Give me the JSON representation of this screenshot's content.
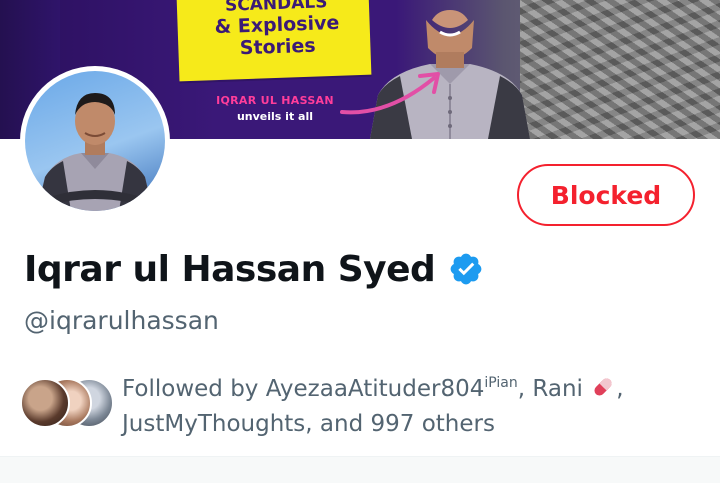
{
  "banner": {
    "headline_line1": "SCANDALS",
    "headline_line2": "& Explosive",
    "headline_line3": "Stories",
    "caption_name": "IQRAR UL HASSAN",
    "caption_sub": "unveils it all",
    "sticker_color": "#f6ea1a",
    "headline_color": "#3b1a77",
    "caption_accent": "#ff3d9a"
  },
  "profile": {
    "display_name": "Iqrar ul Hassan Syed",
    "handle": "@iqrarulhassan",
    "verified": true,
    "verified_color": "#1d9bf0",
    "blocked_label": "Blocked",
    "blocked_color": "#f4212e"
  },
  "followed_by": {
    "prefix": "Followed by ",
    "name1": "AyezaaAtituder804",
    "name1_suffix": "iPian",
    "sep1": ", ",
    "name2": "Rani",
    "name2_icon": "pill-icon",
    "sep2": ",",
    "name3": "JustMyThoughts",
    "sep3": ", and ",
    "others": "997 others"
  },
  "colors": {
    "text_primary": "#0f1419",
    "text_secondary": "#536471",
    "background": "#ffffff"
  }
}
